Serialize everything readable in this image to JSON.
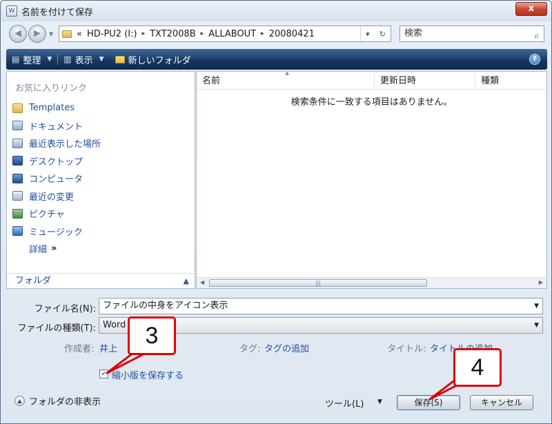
{
  "window": {
    "title": "名前を付けて保存",
    "title_icon": "W",
    "close_glyph": "x"
  },
  "nav": {
    "back_glyph": "◀",
    "forward_glyph": "▶",
    "dropdown_glyph": "▼"
  },
  "address": {
    "prefix": "«",
    "crumbs": [
      "HD-PU2 (I:)",
      "TXT2008B",
      "ALLABOUT",
      "20080421"
    ],
    "separator": "▸",
    "dropdown_glyph": "▾",
    "refresh_glyph": "↻"
  },
  "search": {
    "placeholder": "検索",
    "icon_glyph": "⌕"
  },
  "toolbar": {
    "organize": "整理",
    "views": "表示",
    "new_folder": "新しいフォルダ",
    "dropdown_glyph": "▼",
    "help_glyph": "?"
  },
  "sidebar": {
    "header": "お気に入りリンク",
    "items": [
      {
        "label": "Templates",
        "icon": "folder-icon"
      },
      {
        "label": "ドキュメント",
        "icon": "documents-icon"
      },
      {
        "label": "最近表示した場所",
        "icon": "recent-places-icon"
      },
      {
        "label": "デスクトップ",
        "icon": "desktop-icon"
      },
      {
        "label": "コンピュータ",
        "icon": "computer-icon"
      },
      {
        "label": "最近の変更",
        "icon": "recent-changes-icon"
      },
      {
        "label": "ピクチャ",
        "icon": "pictures-icon"
      },
      {
        "label": "ミュージック",
        "icon": "music-icon"
      }
    ],
    "more_label": "詳細",
    "more_glyph": "»",
    "folders_label": "フォルダ",
    "folders_glyph": "▲"
  },
  "filelist": {
    "columns": [
      "名前",
      "更新日時",
      "種類"
    ],
    "empty_message": "検索条件に一致する項目はありません。",
    "scroll_left": "◀",
    "scroll_right": "▶",
    "thumb_grip": "|||"
  },
  "form": {
    "filename_label": "ファイル名(N):",
    "filename_value": "ファイルの中身をアイコン表示",
    "filetype_label": "ファイルの種類(T):",
    "filetype_value": "Word",
    "author_label": "作成者:",
    "author_value": "井上",
    "tags_label": "タグ:",
    "tags_value": "タグの追加",
    "title_label": "タイトル:",
    "title_value": "タイトルの追加",
    "thumbnail_label": "縮小版を保存する",
    "thumbnail_checked": "✓",
    "dropdown_glyph": "▼"
  },
  "footer": {
    "hide_folders": "フォルダの非表示",
    "hide_glyph": "▲",
    "tools": "ツール(L)",
    "tools_glyph": "▼",
    "save": "保存(S)",
    "cancel": "キャンセル"
  },
  "callouts": {
    "first": "3",
    "second": "4",
    "color": "#e00000"
  }
}
